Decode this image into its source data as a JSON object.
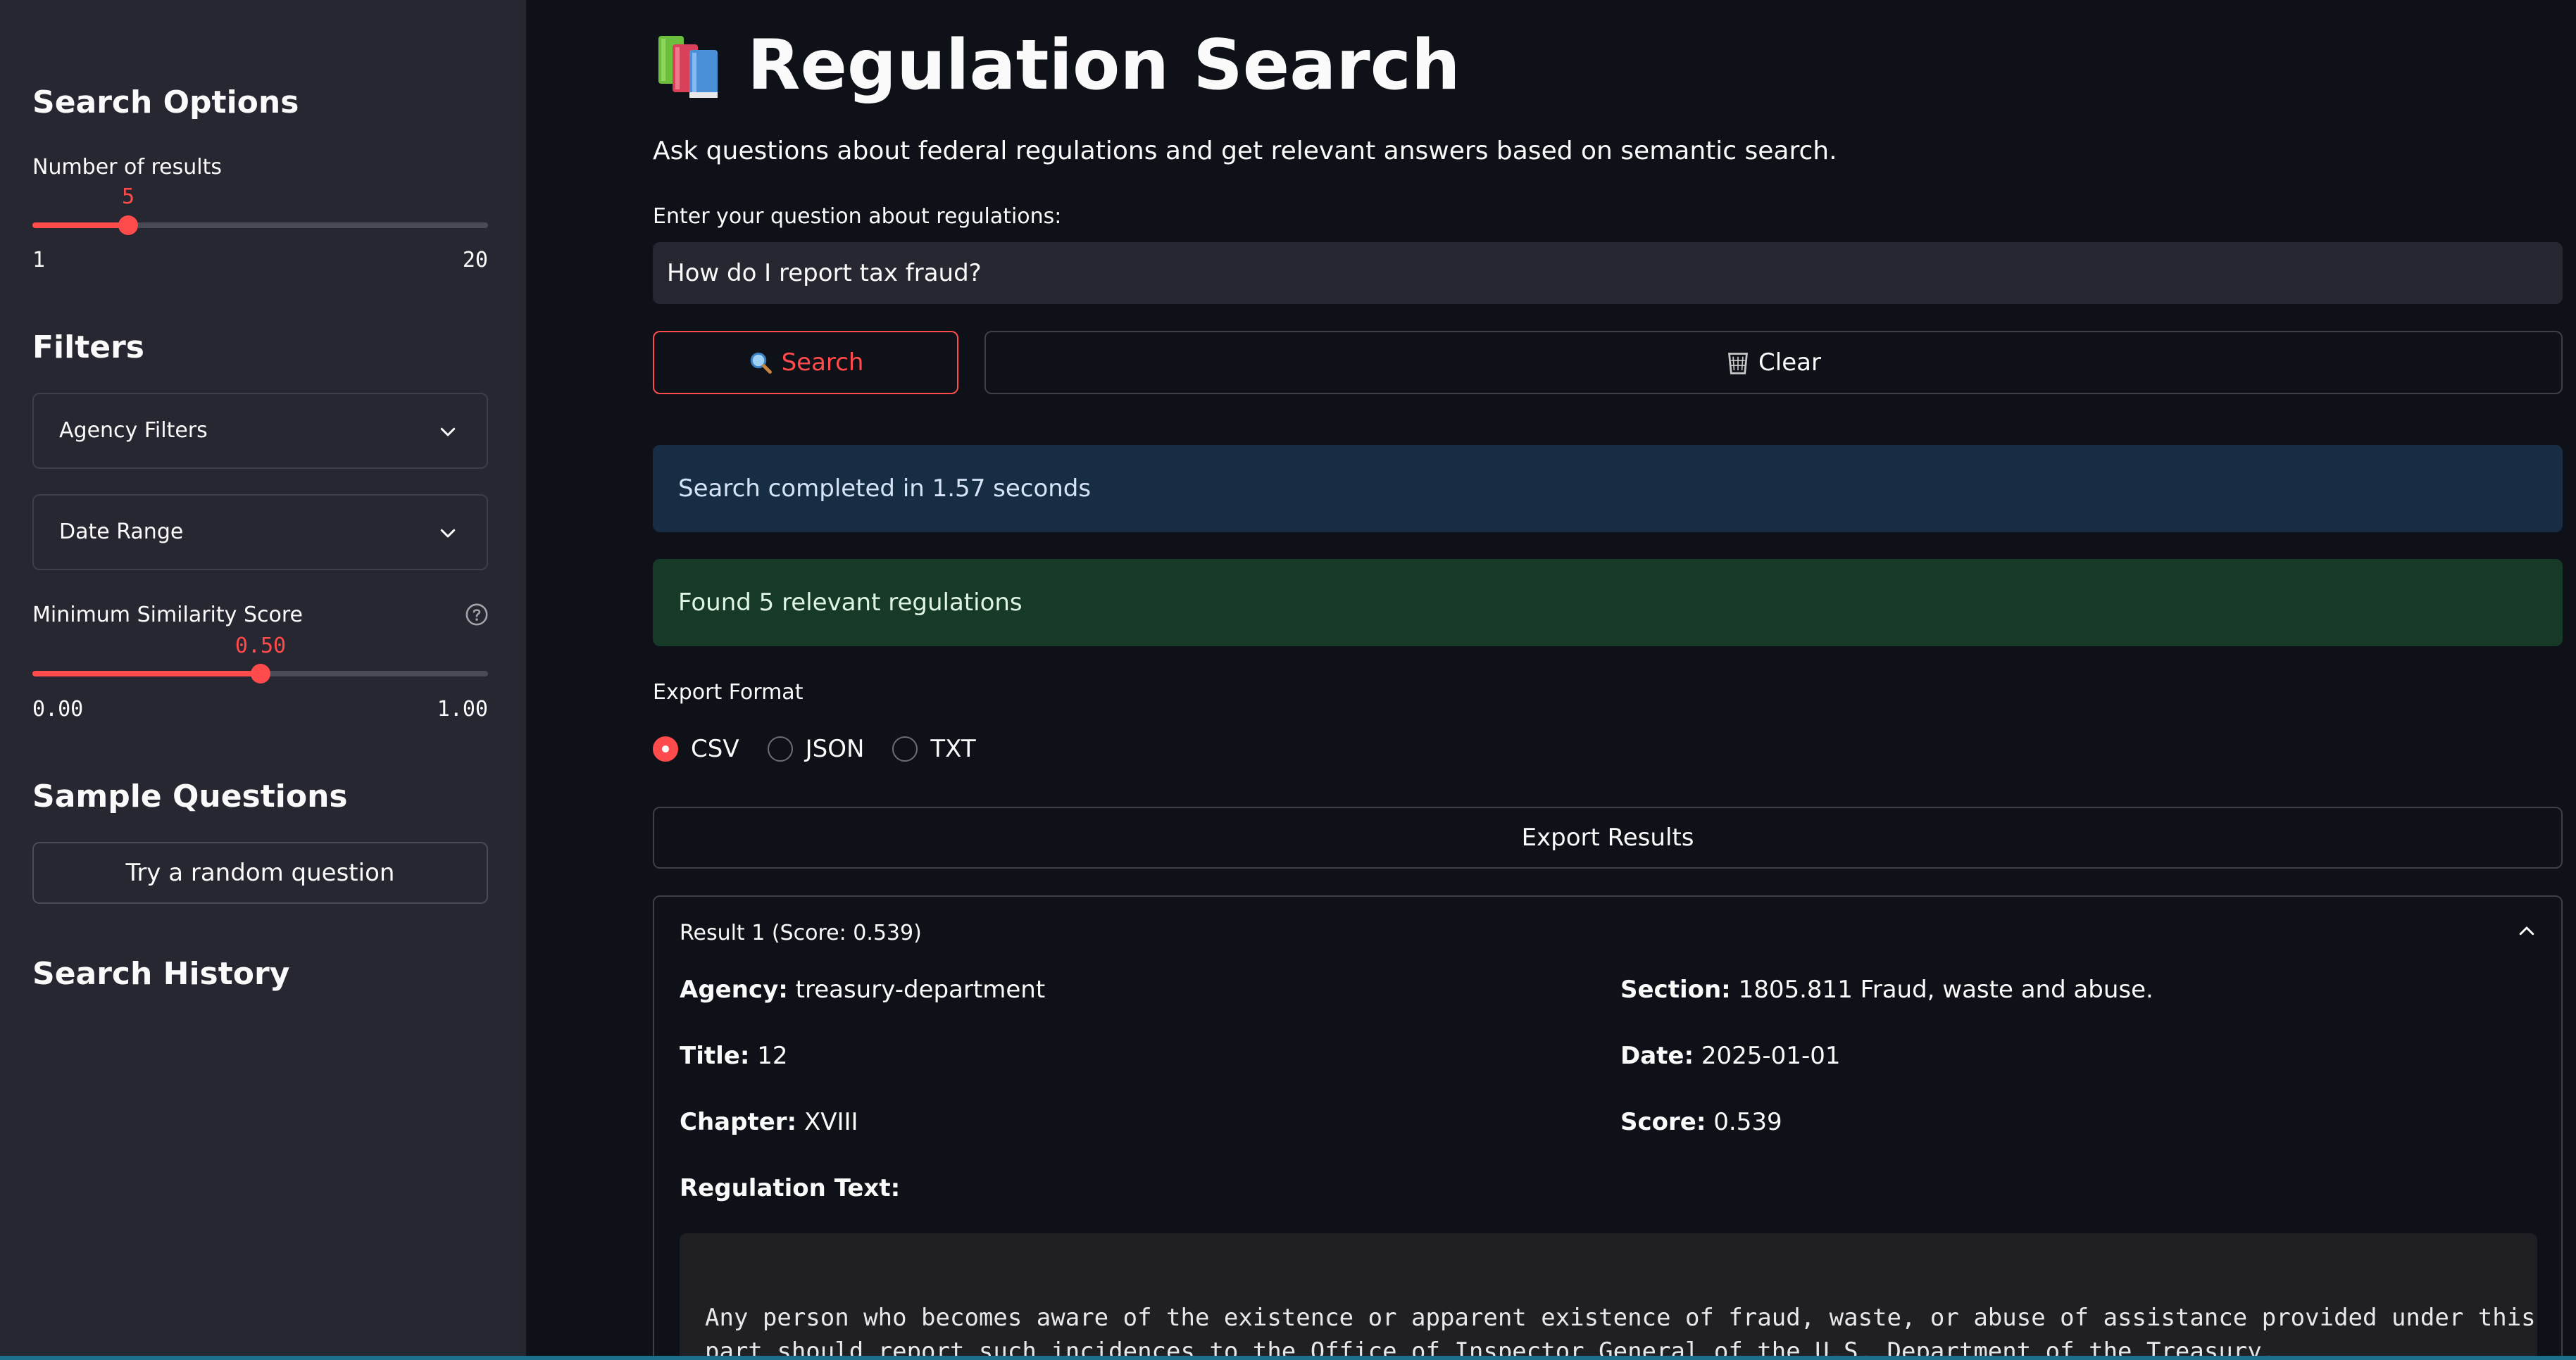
{
  "sidebar": {
    "search_options_heading": "Search Options",
    "num_results": {
      "label": "Number of results",
      "value": "5",
      "min": "1",
      "max": "20",
      "fraction": 0.21
    },
    "filters_heading": "Filters",
    "agency_filters_label": "Agency Filters",
    "date_range_label": "Date Range",
    "similarity": {
      "label": "Minimum Similarity Score",
      "value": "0.50",
      "min": "0.00",
      "max": "1.00",
      "fraction": 0.5
    },
    "sample_questions_heading": "Sample Questions",
    "random_question_button": "Try a random question",
    "search_history_heading": "Search History"
  },
  "main": {
    "title": "Regulation Search",
    "subtitle": "Ask questions about federal regulations and get relevant answers based on semantic search.",
    "question_label": "Enter your question about regulations:",
    "question_value": "How do I report tax fraud?",
    "search_button": "Search",
    "clear_button": "Clear",
    "info_message": "Search completed in 1.57 seconds",
    "success_message": "Found 5 relevant regulations",
    "export_format_label": "Export Format",
    "export_options": [
      "CSV",
      "JSON",
      "TXT"
    ],
    "export_selected": "CSV",
    "export_button": "Export Results"
  },
  "result": {
    "header": "Result 1 (Score: 0.539)",
    "agency_label": "Agency:",
    "agency": "treasury-department",
    "section_label": "Section:",
    "section": "1805.811 Fraud, waste and abuse.",
    "title_label": "Title:",
    "title": "12",
    "date_label": "Date:",
    "date": "2025-01-01",
    "chapter_label": "Chapter:",
    "chapter": "XVIII",
    "score_label": "Score:",
    "score": "0.539",
    "text_label": "Regulation Text:",
    "text": "Any person who becomes aware of the existence or apparent existence of fraud, waste, or abuse of assistance provided under this\npart should report such incidences to the Office of Inspector General of the U.S. Department of the Treasury."
  },
  "colors": {
    "accent": "#ff4b4b",
    "sidebar_bg": "#262730",
    "main_bg": "#0e1117",
    "info_bg": "#172d43",
    "success_bg": "#173928"
  },
  "icons": [
    "books-icon",
    "magnifier-icon",
    "wastebasket-icon",
    "chevron-down-icon",
    "chevron-up-icon",
    "help-icon"
  ]
}
